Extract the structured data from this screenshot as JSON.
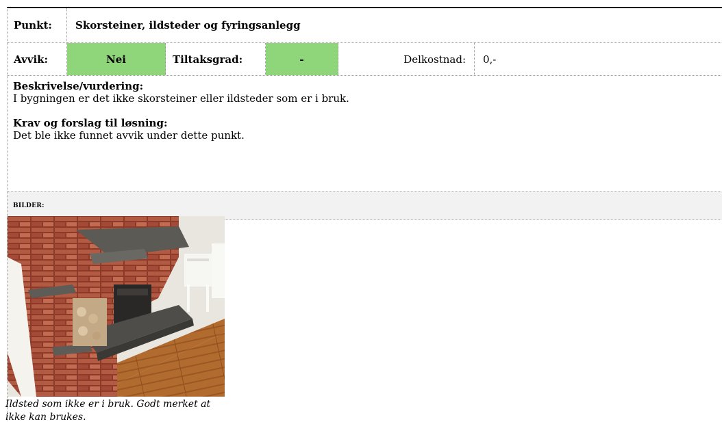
{
  "header": {
    "punkt_label": "Punkt:",
    "punkt_title": "Skorsteiner, ildsteder og fyringsanlegg"
  },
  "status_row": {
    "avvik_label": "Avvik:",
    "avvik_value": "Nei",
    "tiltaksgrad_label": "Tiltaksgrad:",
    "tiltaksgrad_value": "-",
    "delkostnad_label": "Delkostnad:",
    "delkostnad_value": "0,-"
  },
  "colors": {
    "status_green": "#8fd57a",
    "bilder_bg": "#f2f2f2"
  },
  "description": {
    "heading": "Beskrivelse/vurdering:",
    "text": "I bygningen er det ikke skorsteiner eller ildsteder som er i bruk."
  },
  "requirements": {
    "heading": "Krav og forslag til løsning:",
    "text": "Det ble ikke funnet avvik under dette punkt."
  },
  "images_section": {
    "label": "BILDER:",
    "caption_line1": "Ildsted som ikke er i bruk. Godt merket at",
    "caption_line2": "ikke kan brukes."
  }
}
